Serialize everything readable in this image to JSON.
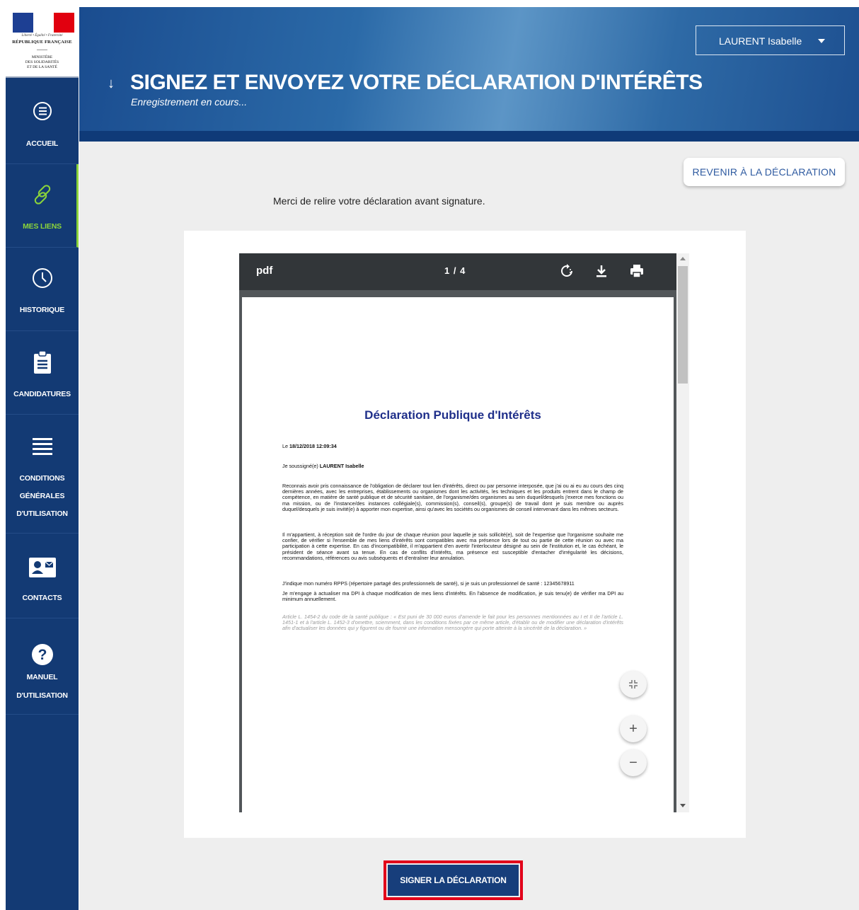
{
  "logo": {
    "devise": "Liberté • Égalité • Fraternité",
    "republique": "RÉPUBLIQUE FRANÇAISE",
    "ministere": "MINISTÈRE\nDES SOLIDARITÉS\nET DE LA SANTÉ"
  },
  "sidebar": {
    "items": [
      {
        "label": "ACCUEIL",
        "icon": "list-circle-icon"
      },
      {
        "label": "MES LIENS",
        "icon": "link-icon",
        "active": true
      },
      {
        "label": "HISTORIQUE",
        "icon": "clock-icon"
      },
      {
        "label": "CANDIDATURES",
        "icon": "clipboard-icon"
      },
      {
        "label": "CONDITIONS",
        "label2": "GÉNÉRALES",
        "label3": "D'UTILISATION",
        "icon": "lines-icon"
      },
      {
        "label": "CONTACTS",
        "icon": "contact-card-icon"
      },
      {
        "label": "MANUEL",
        "label2": "D'UTILISATION",
        "icon": "help-icon"
      }
    ]
  },
  "header": {
    "user_name": "LAURENT Isabelle",
    "title": "SIGNEZ ET ENVOYEZ VOTRE DÉCLARATION D'INTÉRÊTS",
    "status": "Enregistrement en cours..."
  },
  "main": {
    "back_label": "REVENIR À LA DÉCLARATION",
    "intro": "Merci de relire votre déclaration avant signature.",
    "sign_label": "SIGNER LA DÉCLARATION"
  },
  "pdf": {
    "label": "pdf",
    "page_indicator": "1 / 4",
    "document": {
      "title": "Déclaration Publique d'Intérêts",
      "date_prefix": "Le",
      "date": "18/12/2018 12:09:34",
      "signer_prefix": "Je soussigné(e)",
      "signer": "LAURENT Isabelle",
      "para1": "Reconnais avoir pris connaissance de l'obligation de déclarer tout lien d'intérêts, direct ou par personne interposée, que j'ai ou ai eu au cours des cinq dernières années, avec les entreprises, établissements ou organismes dont les activités, les techniques et les produits entrent dans le champ de compétence, en matière de santé publique et de sécurité sanitaire, de l'organisme/des organismes au sein duquel/desquels j'exerce mes fonctions ou ma mission, ou de l'instance/des instances collégiale(s), commission(s), conseil(s), groupe(s) de travail dont je suis membre ou auprès duquel/desquels je suis invité(e) à apporter mon expertise, ainsi qu'avec les sociétés ou organismes de conseil intervenant dans les mêmes secteurs.",
      "para2": "Il m'appartient, à réception soit de l'ordre du jour de chaque réunion pour laquelle je suis sollicité(e), soit de l'expertise que l'organisme souhaite me confier, de vérifier si l'ensemble de mes liens d'intérêts sont compatibles avec ma présence lors de tout ou partie de cette réunion ou avec ma participation à cette expertise. En cas d'incompatibilité, il m'appartient d'en avertir l'interlocuteur désigné au sein de l'institution et, le cas échéant, le président de séance avant sa tenue. En cas de conflits d'intérêts, ma présence est susceptible d'entacher d'irrégularité les décisions, recommandations, références ou avis subséquents et d'entraîner leur annulation.",
      "para3": "J'indique mon numéro RPPS (répertoire partagé des professionnels de santé), si je suis un professionnel de santé : 12345678911",
      "para4": "Je m'engage à actualiser ma DPI à chaque modification de mes liens d'intérêts. En l'absence de modification, je suis tenu(e) de vérifier ma DPI au minimum annuellement.",
      "legal": "Article L. 1454-2 du code de la santé publique : « Est puni de 30 000 euros d'amende le fait pour les personnes mentionnées au I et II de l'article L. 1451-1 et à l'article L. 1452-3 d'omettre, sciemment, dans les conditions fixées par ce même article, d'établir ou de modifier une déclaration d'intérêts afin d'actualiser les données qui y figurent ou de fournir une information mensongère qui porte atteinte à la sincérité de la déclaration. »"
    }
  },
  "colors": {
    "sidebar": "#133a74",
    "active": "#8bd43a",
    "sign_button": "#173e7b",
    "highlight": "#e2001a"
  }
}
